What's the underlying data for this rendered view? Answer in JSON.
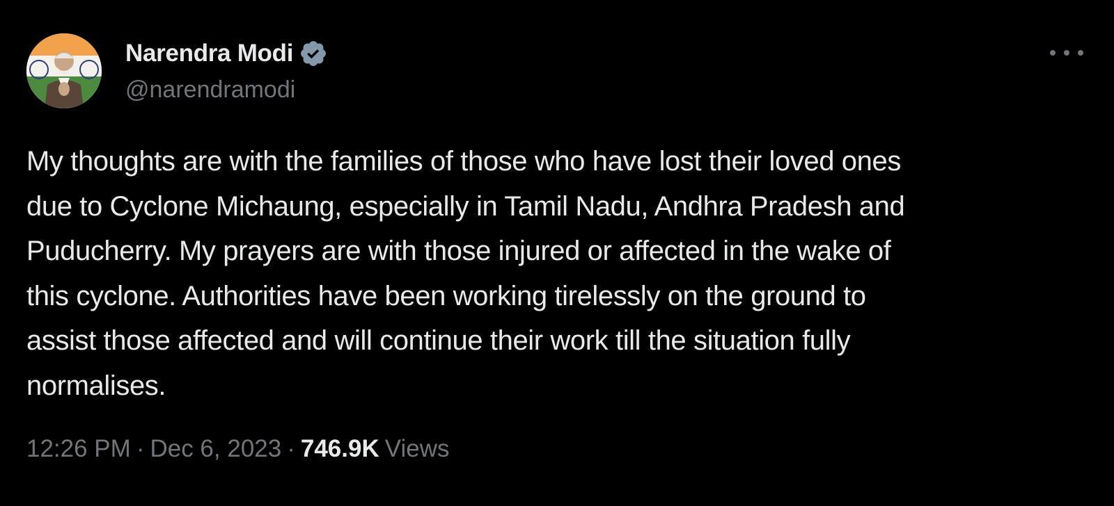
{
  "author": {
    "display_name": "Narendra Modi",
    "handle": "@narendramodi",
    "verified": true,
    "verified_color": "#829aab",
    "avatar_icon": "profile-photo"
  },
  "tweet": {
    "text_lines": [
      "My thoughts are with the families of those who have lost their loved ones",
      "due to Cyclone Michaung, especially in Tamil Nadu, Andhra Pradesh and",
      "Puducherry. My prayers are with those injured or affected in the wake of",
      "this cyclone. Authorities have been working tirelessly on the ground to",
      "assist those affected and will continue their work till the situation fully",
      "normalises."
    ]
  },
  "meta": {
    "time": "12:26 PM",
    "separator": "·",
    "date": "Dec 6, 2023",
    "views_count": "746.9K",
    "views_label": "Views"
  },
  "colors": {
    "background": "#000000",
    "primary_text": "#e7e9ea",
    "secondary_text": "#71767b"
  },
  "icons": {
    "more": "more-horizontal-icon",
    "verified": "verified-badge-icon"
  }
}
